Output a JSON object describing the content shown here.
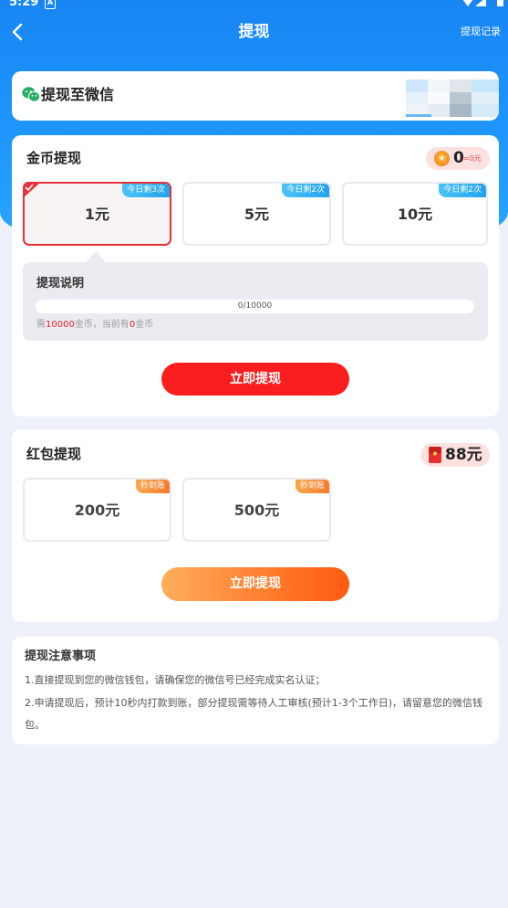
{
  "status_bar": {
    "time": "5:29",
    "notification_glyph": "A"
  },
  "header": {
    "title": "提现",
    "records_label": "提现记录",
    "back_icon": "chevron-left-icon"
  },
  "wechat_target": {
    "label": "提现至微信",
    "icon": "wechat-icon"
  },
  "coin_withdraw": {
    "title": "金币提现",
    "balance": {
      "value": "0",
      "approx": "≈0元",
      "icon": "coin-icon"
    },
    "selected_index": 0,
    "options": [
      {
        "amount": "1元",
        "badge": "今日剩3次"
      },
      {
        "amount": "5元",
        "badge": "今日剩2次"
      },
      {
        "amount": "10元",
        "badge": "今日剩2次"
      }
    ],
    "explain": {
      "title": "提现说明",
      "progress_text": "0/10000",
      "progress_fraction": 0,
      "req_prefix": "需",
      "req_amount": "10000",
      "req_mid": "金币，当前有",
      "req_current": "0",
      "req_suffix": "金币"
    },
    "button": "立即提现"
  },
  "red_packet": {
    "title": "红包提现",
    "balance": "88元",
    "icon": "red-envelope-icon",
    "options": [
      {
        "amount": "200元",
        "badge": "秒到账"
      },
      {
        "amount": "500元",
        "badge": "秒到账"
      }
    ],
    "button": "立即提现"
  },
  "notes": {
    "title": "提现注意事项",
    "items": [
      "1.直接提现到您的微信钱包，请确保您的微信号已经完成实名认证；",
      "2.申请提现后，预计10秒内打款到账，部分提现需等待人工审核(预计1-3个工作日)，请留意您的微信钱包。"
    ]
  },
  "colors": {
    "header_blue": "#1c92fb",
    "primary_red": "#fa1e1e",
    "selected_border": "#e6303a",
    "orange_start": "#ffae5c",
    "orange_end": "#ff5a10",
    "badge_blue": "#22a3ee",
    "badge_orange": "#f57a2a",
    "pill_bg": "#fde1e1",
    "page_bg": "#eef0fa"
  }
}
